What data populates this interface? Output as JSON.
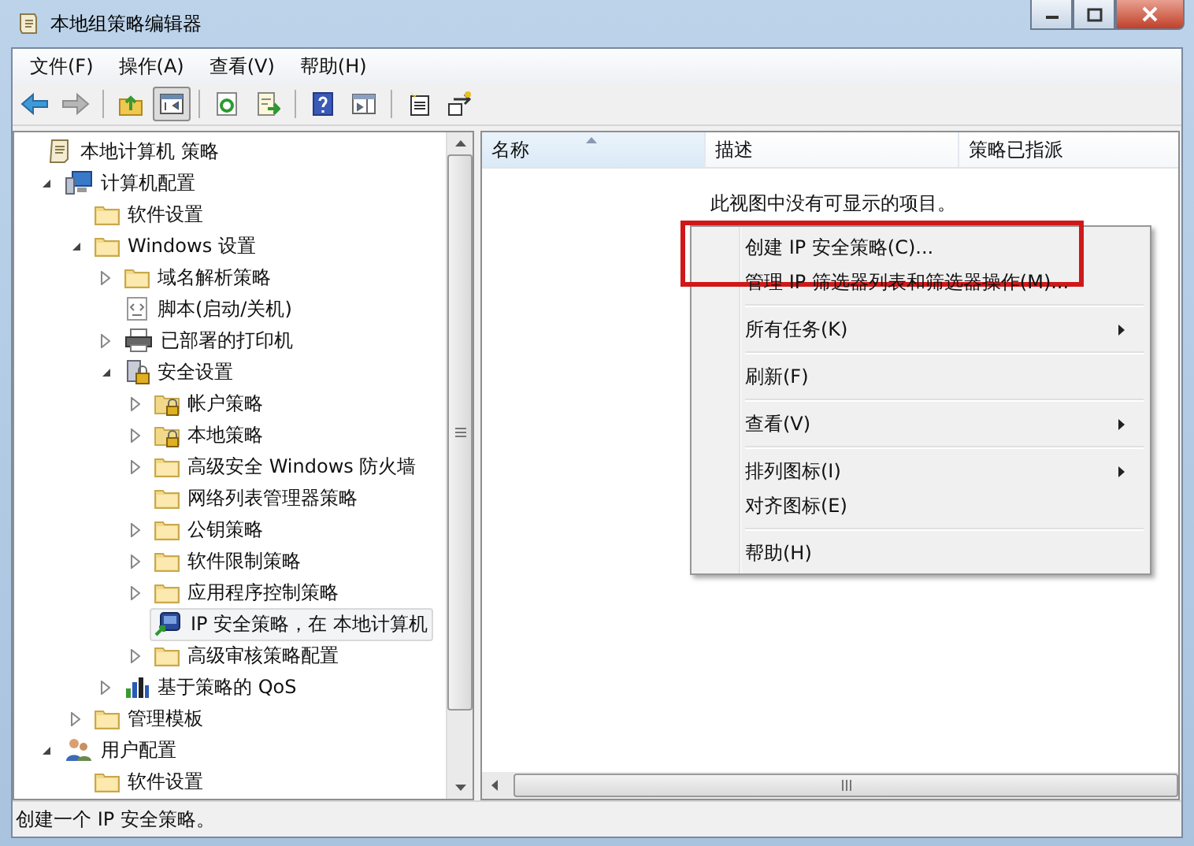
{
  "window": {
    "title": "本地组策略编辑器"
  },
  "menu": [
    "文件(F)",
    "操作(A)",
    "查看(V)",
    "帮助(H)"
  ],
  "toolbar": [
    {
      "kind": "back",
      "pressed": false,
      "disabled": false
    },
    {
      "kind": "forward",
      "pressed": false,
      "disabled": true
    },
    {
      "kind": "separator"
    },
    {
      "kind": "up",
      "pressed": false,
      "disabled": false
    },
    {
      "kind": "tree-toggle",
      "pressed": true,
      "disabled": false
    },
    {
      "kind": "separator"
    },
    {
      "kind": "refresh",
      "pressed": false,
      "disabled": false
    },
    {
      "kind": "export",
      "pressed": false,
      "disabled": false
    },
    {
      "kind": "separator"
    },
    {
      "kind": "help",
      "pressed": false,
      "disabled": false
    },
    {
      "kind": "panel",
      "pressed": false,
      "disabled": false
    },
    {
      "kind": "separator"
    },
    {
      "kind": "new-doc",
      "pressed": false,
      "disabled": false
    },
    {
      "kind": "assign",
      "pressed": false,
      "disabled": false
    }
  ],
  "tree": [
    {
      "label": "本地计算机 策略",
      "kind": "scroll",
      "selected": false,
      "children": [
        {
          "label": "计算机配置",
          "kind": "computer",
          "expanded": true,
          "selected": false,
          "children": [
            {
              "label": "软件设置",
              "kind": "folder",
              "selected": false
            },
            {
              "label": "Windows 设置",
              "kind": "folder",
              "expanded": true,
              "selected": false,
              "children": [
                {
                  "label": "域名解析策略",
                  "kind": "folder",
                  "expanded": false,
                  "selected": false
                },
                {
                  "label": "脚本(启动/关机)",
                  "kind": "script",
                  "selected": false
                },
                {
                  "label": "已部署的打印机",
                  "kind": "printer",
                  "expanded": false,
                  "selected": false
                },
                {
                  "label": "安全设置",
                  "kind": "lock",
                  "expanded": true,
                  "selected": false,
                  "children": [
                    {
                      "label": "帐户策略",
                      "kind": "lock-folder",
                      "expanded": false,
                      "selected": false
                    },
                    {
                      "label": "本地策略",
                      "kind": "lock-folder",
                      "expanded": false,
                      "selected": false
                    },
                    {
                      "label": "高级安全 Windows 防火墙",
                      "kind": "folder",
                      "expanded": false,
                      "selected": false
                    },
                    {
                      "label": "网络列表管理器策略",
                      "kind": "folder",
                      "selected": false
                    },
                    {
                      "label": "公钥策略",
                      "kind": "folder",
                      "expanded": false,
                      "selected": false
                    },
                    {
                      "label": "软件限制策略",
                      "kind": "folder",
                      "expanded": false,
                      "selected": false
                    },
                    {
                      "label": "应用程序控制策略",
                      "kind": "folder",
                      "expanded": false,
                      "selected": false
                    },
                    {
                      "label": "IP 安全策略，在 本地计算机",
                      "kind": "ip",
                      "selected": true
                    },
                    {
                      "label": "高级审核策略配置",
                      "kind": "folder",
                      "expanded": false,
                      "selected": false
                    }
                  ]
                },
                {
                  "label": "基于策略的 QoS",
                  "kind": "chart",
                  "expanded": false,
                  "selected": false
                }
              ]
            },
            {
              "label": "管理模板",
              "kind": "folder",
              "expanded": false,
              "selected": false
            }
          ]
        },
        {
          "label": "用户配置",
          "kind": "user",
          "expanded": true,
          "selected": false,
          "children": [
            {
              "label": "软件设置",
              "kind": "folder",
              "selected": false
            }
          ]
        }
      ]
    }
  ],
  "list": {
    "columns": [
      {
        "label": "名称",
        "sorted": true
      },
      {
        "label": "描述",
        "sorted": false
      },
      {
        "label": "策略已指派",
        "sorted": false
      }
    ],
    "empty_message": "此视图中没有可显示的项目。"
  },
  "context_menu": [
    {
      "kind": "item",
      "label": "创建 IP 安全策略(C)...",
      "submenu": false,
      "annotated": true
    },
    {
      "kind": "item",
      "label": "管理 IP 筛选器列表和筛选器操作(M)...",
      "submenu": false,
      "annotated": false
    },
    {
      "kind": "separator"
    },
    {
      "kind": "item",
      "label": "所有任务(K)",
      "submenu": true,
      "annotated": false
    },
    {
      "kind": "separator"
    },
    {
      "kind": "item",
      "label": "刷新(F)",
      "submenu": false,
      "annotated": false
    },
    {
      "kind": "separator"
    },
    {
      "kind": "item",
      "label": "查看(V)",
      "submenu": true,
      "annotated": false
    },
    {
      "kind": "separator"
    },
    {
      "kind": "item",
      "label": "排列图标(I)",
      "submenu": true,
      "annotated": false
    },
    {
      "kind": "item",
      "label": "对齐图标(E)",
      "submenu": false,
      "annotated": false
    },
    {
      "kind": "separator"
    },
    {
      "kind": "item",
      "label": "帮助(H)",
      "submenu": false,
      "annotated": false
    }
  ],
  "status_bar": "创建一个 IP 安全策略。"
}
